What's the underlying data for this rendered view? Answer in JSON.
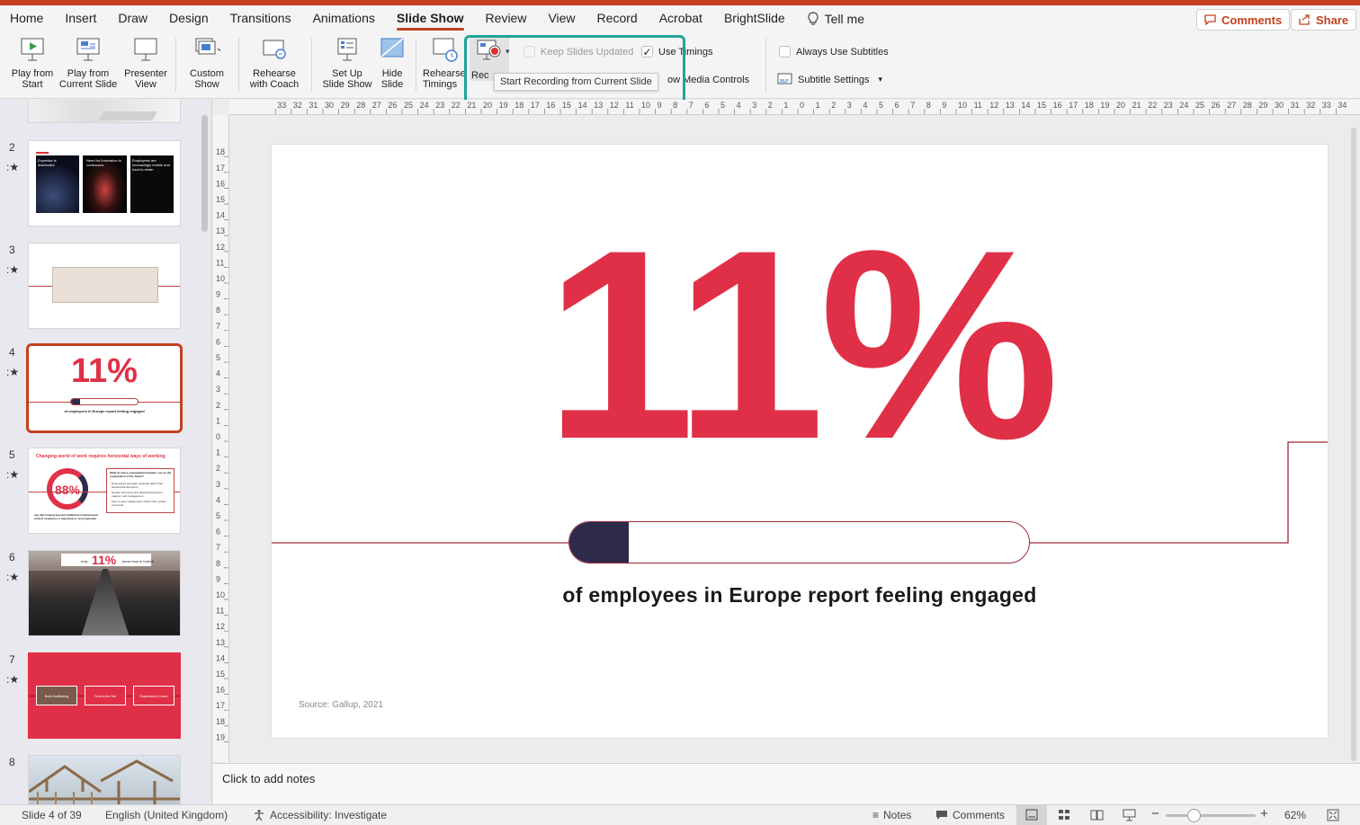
{
  "tabs": [
    {
      "label": "Home",
      "active": false
    },
    {
      "label": "Insert",
      "active": false
    },
    {
      "label": "Draw",
      "active": false
    },
    {
      "label": "Design",
      "active": false
    },
    {
      "label": "Transitions",
      "active": false
    },
    {
      "label": "Animations",
      "active": false
    },
    {
      "label": "Slide Show",
      "active": true
    },
    {
      "label": "Review",
      "active": false
    },
    {
      "label": "View",
      "active": false
    },
    {
      "label": "Record",
      "active": false
    },
    {
      "label": "Acrobat",
      "active": false
    },
    {
      "label": "BrightSlide",
      "active": false
    }
  ],
  "tell_me": "Tell me",
  "top_buttons": {
    "comments": "Comments",
    "share": "Share"
  },
  "ribbon": {
    "play_from_start": "Play from Start",
    "play_from_current": "Play from Current Slide",
    "presenter_view": "Presenter View",
    "custom_show": "Custom Show",
    "rehearse_with_coach": "Rehearse with Coach",
    "set_up_slide_show": "Set Up Slide Show",
    "hide_slide": "Hide Slide",
    "rehearse_timings": "Rehearse Timings",
    "record": "Rec",
    "keep_slides_updated": "Keep Slides Updated",
    "use_timings": "Use Timings",
    "show_media_controls": "ow Media Controls",
    "always_use_subtitles": "Always Use Subtitles",
    "subtitle_settings": "Subtitle Settings"
  },
  "tooltip": "Start Recording from Current Slide",
  "thumbnails": [
    {
      "num": "2",
      "texts": [
        "Expertise is distributed",
        "Need for innovation is continuous",
        "Employees are increasingly mobile and hard to retain"
      ]
    },
    {
      "num": "3"
    },
    {
      "num": "4",
      "big": "11%",
      "caption": "of employees in Europe report feeling engaged"
    },
    {
      "num": "5",
      "title": "Changing world of work requires horizontal ways of working",
      "big": "88%",
      "side": "What do these organizational leaders see as the organization of the future?",
      "bullets": [
        "Empowered and agile networks rather than hierarchical structures",
        "Greater autonomy and distributed decision making / self-management",
        "Peer-to-peer collaboration rather than vertical command"
      ],
      "left_text": "say that moving beyond traditional command and control structures is important or very important"
    },
    {
      "num": "6",
      "pre": "only",
      "big": "11%",
      "post": "know how to build it"
    },
    {
      "num": "7",
      "labels": [
        "Build Scaffolding",
        "Tend to the Soil",
        "Experiment & Learn"
      ]
    },
    {
      "num": "8"
    }
  ],
  "slide": {
    "big_number": "11%",
    "progress": 0.13,
    "caption": "of employees in Europe report feeling engaged",
    "source": "Source: Gallup, 2021"
  },
  "notes_placeholder": "Click to add notes",
  "status": {
    "slide_info": "Slide 4 of 39",
    "language": "English (United Kingdom)",
    "accessibility": "Accessibility: Investigate",
    "notes": "Notes",
    "comments": "Comments",
    "zoom": "62%"
  },
  "colors": {
    "accent": "#c4401f",
    "highlight": "#1ea59a",
    "slide_red": "#e03048",
    "navy": "#2d2a4a"
  }
}
